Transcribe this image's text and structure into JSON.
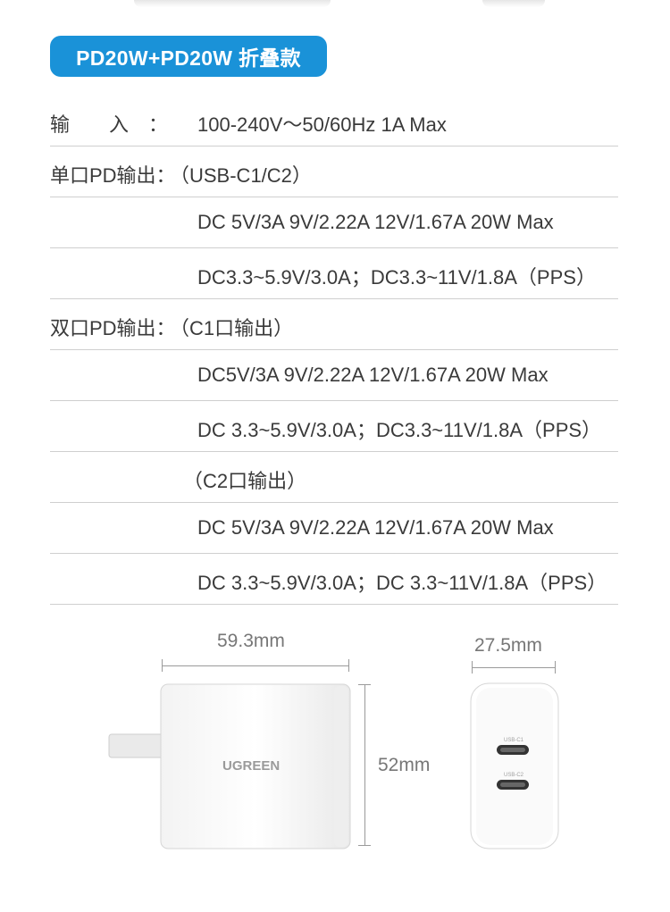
{
  "badge": {
    "label": "PD20W+PD20W 折叠款"
  },
  "specs": {
    "input_label": "输　　入　：",
    "input_value": "100-240V～50/60Hz 1A Max",
    "single_label": "单口PD输出：",
    "single_port": "（USB-C1/C2）",
    "single_line1": "DC 5V/3A 9V/2.22A 12V/1.67A  20W Max",
    "single_line2": "DC3.3~5.9V/3.0A；DC3.3~11V/1.8A（PPS）",
    "dual_label": "双口PD输出：",
    "dual_c1": "（C1口输出）",
    "dual_c1_line1": "DC5V/3A  9V/2.22A  12V/1.67A  20W Max",
    "dual_c1_line2": "DC 3.3~5.9V/3.0A；DC3.3~11V/1.8A（PPS）",
    "dual_c2": "（C2口输出）",
    "dual_c2_line1": "DC 5V/3A 9V/2.22A 12V/1.67A 20W Max",
    "dual_c2_line2": "DC 3.3~5.9V/3.0A；DC 3.3~11V/1.8A（PPS）"
  },
  "dimensions": {
    "width": "59.3mm",
    "height": "52mm",
    "depth": "27.5mm"
  },
  "product": {
    "brand": "UGREEN",
    "port1": "USB-C1",
    "port2": "USB-C2"
  }
}
